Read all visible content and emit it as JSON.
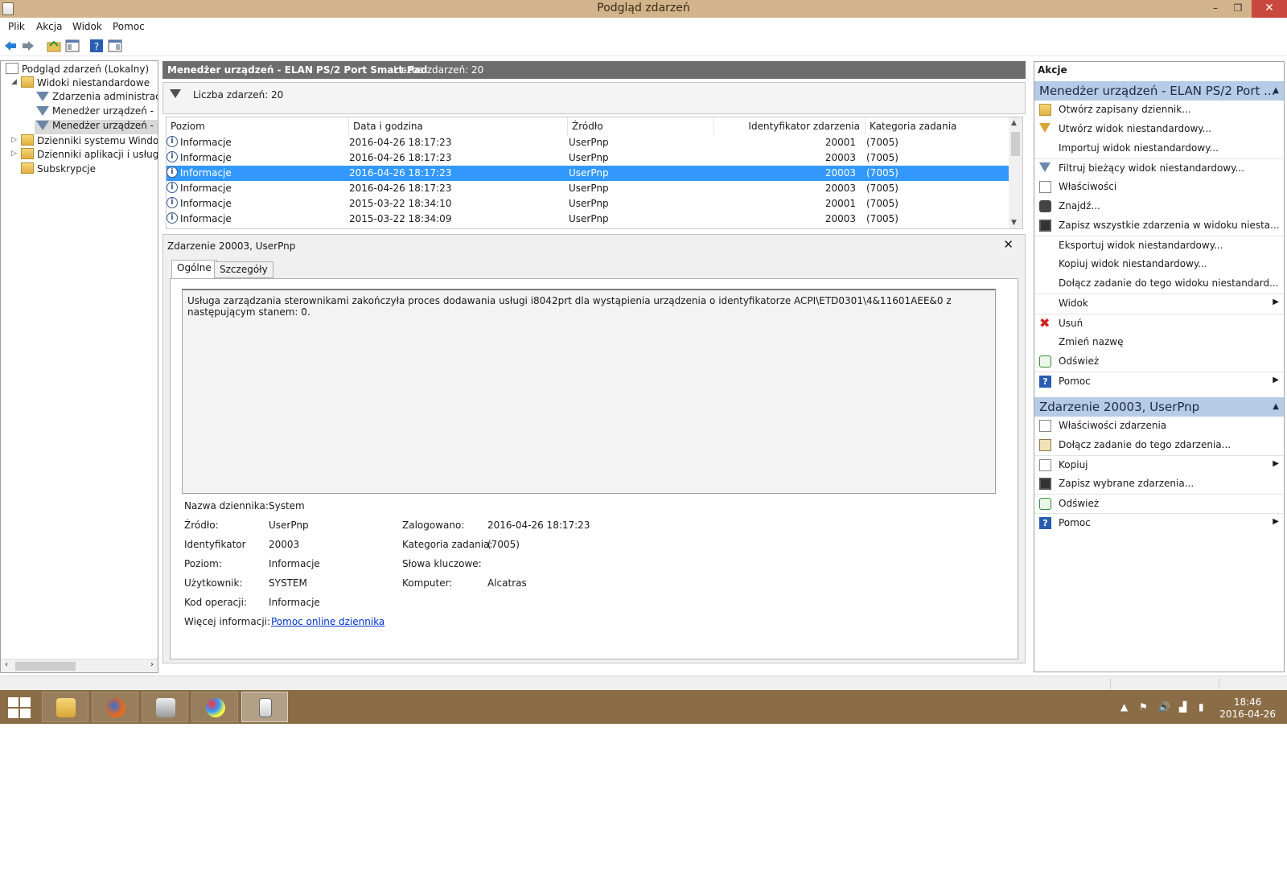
{
  "window": {
    "title": "Podgląd zdarzeń",
    "minimize": "–",
    "restore": "❐",
    "close": "✕"
  },
  "menu": [
    "Plik",
    "Akcja",
    "Widok",
    "Pomoc"
  ],
  "tree": {
    "root": "Podgląd zdarzeń (Lokalny)",
    "custom_views": "Widoki niestandardowe",
    "admin_events": "Zdarzenia administracyjne",
    "device_mgr_1": "Menedżer urządzeń - Mo",
    "device_mgr_2": "Menedżer urządzeń - ELA",
    "windows_logs": "Dzienniki systemu Windows",
    "app_logs": "Dzienniki aplikacji i usług",
    "subscriptions": "Subskrypcje"
  },
  "center": {
    "title": "Menedżer urządzeń - ELAN PS/2 Port Smart-Pad",
    "count": "Liczba zdarzeń: 20",
    "filter_text": "Liczba zdarzeń: 20"
  },
  "table": {
    "headers": [
      "Poziom",
      "Data i godzina",
      "Źródło",
      "Identyfikator zdarzenia",
      "Kategoria zadania"
    ],
    "rows": [
      {
        "level": "Informacje",
        "date": "2016-04-26 18:17:23",
        "source": "UserPnp",
        "id": "20001",
        "cat": "(7005)"
      },
      {
        "level": "Informacje",
        "date": "2016-04-26 18:17:23",
        "source": "UserPnp",
        "id": "20003",
        "cat": "(7005)"
      },
      {
        "level": "Informacje",
        "date": "2016-04-26 18:17:23",
        "source": "UserPnp",
        "id": "20003",
        "cat": "(7005)"
      },
      {
        "level": "Informacje",
        "date": "2016-04-26 18:17:23",
        "source": "UserPnp",
        "id": "20003",
        "cat": "(7005)"
      },
      {
        "level": "Informacje",
        "date": "2015-03-22 18:34:10",
        "source": "UserPnp",
        "id": "20001",
        "cat": "(7005)"
      },
      {
        "level": "Informacje",
        "date": "2015-03-22 18:34:09",
        "source": "UserPnp",
        "id": "20003",
        "cat": "(7005)"
      }
    ]
  },
  "detail": {
    "title": "Zdarzenie 20003, UserPnp",
    "tab_general": "Ogólne",
    "tab_details": "Szczegóły",
    "description": "Usługa zarządzania sterownikami zakończyła proces dodawania usługi i8042prt dla wystąpienia urządzenia o identyfikatorze ACPI\\ETD0301\\4&11601AEE&0 z następującym stanem: 0.",
    "log_name_label": "Nazwa dziennika:",
    "log_name": "System",
    "source_label": "Źródło:",
    "source": "UserPnp",
    "logged_label": "Zalogowano:",
    "logged": "2016-04-26 18:17:23",
    "id_label": "Identyfikator",
    "id": "20003",
    "task_label": "Kategoria zadania:",
    "task": "(7005)",
    "level_label": "Poziom:",
    "level": "Informacje",
    "keywords_label": "Słowa kluczowe:",
    "user_label": "Użytkownik:",
    "user": "SYSTEM",
    "computer_label": "Komputer:",
    "computer": "Alcatras",
    "opcode_label": "Kod operacji:",
    "opcode": "Informacje",
    "more_label": "Więcej informacji:",
    "more_link": "Pomoc online dziennika"
  },
  "actions": {
    "title": "Akcje",
    "section1": "Menedżer urządzeń - ELAN PS/2 Port ...",
    "section1_items": [
      "Otwórz zapisany dziennik...",
      "Utwórz widok niestandardowy...",
      "Importuj widok niestandardowy...",
      "Filtruj bieżący widok niestandardowy...",
      "Właściwości",
      "Znajdź...",
      "Zapisz wszystkie zdarzenia w widoku niesta...",
      "Eksportuj widok niestandardowy...",
      "Kopiuj widok niestandardowy...",
      "Dołącz zadanie do tego widoku niestandard...",
      "Widok",
      "Usuń",
      "Zmień nazwę",
      "Odśwież",
      "Pomoc"
    ],
    "section2": "Zdarzenie 20003, UserPnp",
    "section2_items": [
      "Właściwości zdarzenia",
      "Dołącz zadanie do tego zdarzenia...",
      "Kopiuj",
      "Zapisz wybrane zdarzenia...",
      "Odśwież",
      "Pomoc"
    ]
  },
  "taskbar": {
    "time": "18:46",
    "date": "2016-04-26"
  },
  "colors": {
    "titlebar": "#d2b48c",
    "taskbar": "#8a6d46",
    "selection": "#3399ff",
    "section_header": "#b6cbe6"
  }
}
